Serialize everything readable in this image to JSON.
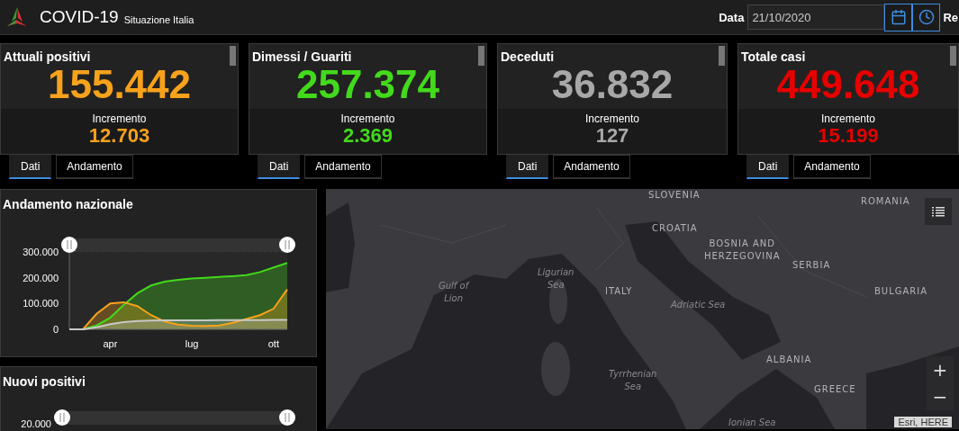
{
  "header": {
    "title": "COVID-19",
    "subtitle": "Situazione Italia",
    "date_label": "Data",
    "date_value": "21/10/2020",
    "cut_label": "Re"
  },
  "cards": [
    {
      "title": "Attuali positivi",
      "value": "155.442",
      "increment_label": "Incremento",
      "increment": "12.703",
      "color": "#f7a21b",
      "tabs": [
        {
          "label": "Dati",
          "selected": true
        },
        {
          "label": "Andamento",
          "selected": false
        }
      ]
    },
    {
      "title": "Dimessi / Guariti",
      "value": "257.374",
      "increment_label": "Incremento",
      "increment": "2.369",
      "color": "#43d91c",
      "tabs": [
        {
          "label": "Dati",
          "selected": true
        },
        {
          "label": "Andamento",
          "selected": false
        }
      ]
    },
    {
      "title": "Deceduti",
      "value": "36.832",
      "increment_label": "Incremento",
      "increment": "127",
      "color": "#a8a8a8",
      "tabs": [
        {
          "label": "Dati",
          "selected": true
        },
        {
          "label": "Andamento",
          "selected": false
        }
      ]
    },
    {
      "title": "Totale casi",
      "value": "449.648",
      "increment_label": "Incremento",
      "increment": "15.199",
      "color": "#e60000",
      "tabs": [
        {
          "label": "Dati",
          "selected": true
        },
        {
          "label": "Andamento",
          "selected": false
        }
      ]
    }
  ],
  "trend_panel": {
    "title": "Andamento nazionale",
    "chart_data": {
      "type": "area",
      "categories": [
        null,
        null,
        null,
        "apr",
        null,
        null,
        null,
        null,
        null,
        "lug",
        null,
        null,
        null,
        null,
        null,
        "ott",
        null
      ],
      "ylim": [
        0,
        300000
      ],
      "grid": true,
      "yticks": [
        {
          "value": 0,
          "label": "0"
        },
        {
          "value": 100000,
          "label": "100.000"
        },
        {
          "value": 200000,
          "label": "200.000"
        },
        {
          "value": 300000,
          "label": "300.000"
        }
      ],
      "series": [
        {
          "color": "#43d91c",
          "values": [
            0,
            0,
            15000,
            45000,
            95000,
            140000,
            170000,
            185000,
            192000,
            197000,
            200000,
            203000,
            206000,
            210000,
            222000,
            240000,
            257000
          ]
        },
        {
          "color": "#f7a21b",
          "values": [
            0,
            0,
            60000,
            100000,
            105000,
            90000,
            55000,
            30000,
            18000,
            14000,
            13000,
            15000,
            25000,
            40000,
            55000,
            80000,
            155000
          ]
        },
        {
          "color": "#c8c8c8",
          "values": [
            0,
            0,
            8000,
            20000,
            28000,
            32000,
            34000,
            35000,
            35000,
            35000,
            35000,
            36000,
            36000,
            36000,
            36000,
            37000,
            37000
          ]
        }
      ]
    }
  },
  "new_panel": {
    "title": "Nuovi positivi",
    "y_tick": "20.000"
  },
  "map": {
    "labels": [
      {
        "text": "SLOVENIA",
        "kind": "country"
      },
      {
        "text": "ROMANIA",
        "kind": "country"
      },
      {
        "text": "CROATIA",
        "kind": "country"
      },
      {
        "text": "BOSNIA AND\nHERZEGOVINA",
        "kind": "country"
      },
      {
        "text": "SERBIA",
        "kind": "country"
      },
      {
        "text": "Gulf of\nLion",
        "kind": "sea"
      },
      {
        "text": "Ligurian\nSea",
        "kind": "sea"
      },
      {
        "text": "ITALY",
        "kind": "country"
      },
      {
        "text": "Adriatic Sea",
        "kind": "sea"
      },
      {
        "text": "BULGARIA",
        "kind": "country"
      },
      {
        "text": "ALBANIA",
        "kind": "country"
      },
      {
        "text": "Tyrrhenian\nSea",
        "kind": "sea"
      },
      {
        "text": "GREECE",
        "kind": "country"
      },
      {
        "text": "Ionian Sea",
        "kind": "sea"
      }
    ],
    "zoom_in": "+",
    "zoom_out": "−",
    "attribution": "Esri, HERE"
  }
}
